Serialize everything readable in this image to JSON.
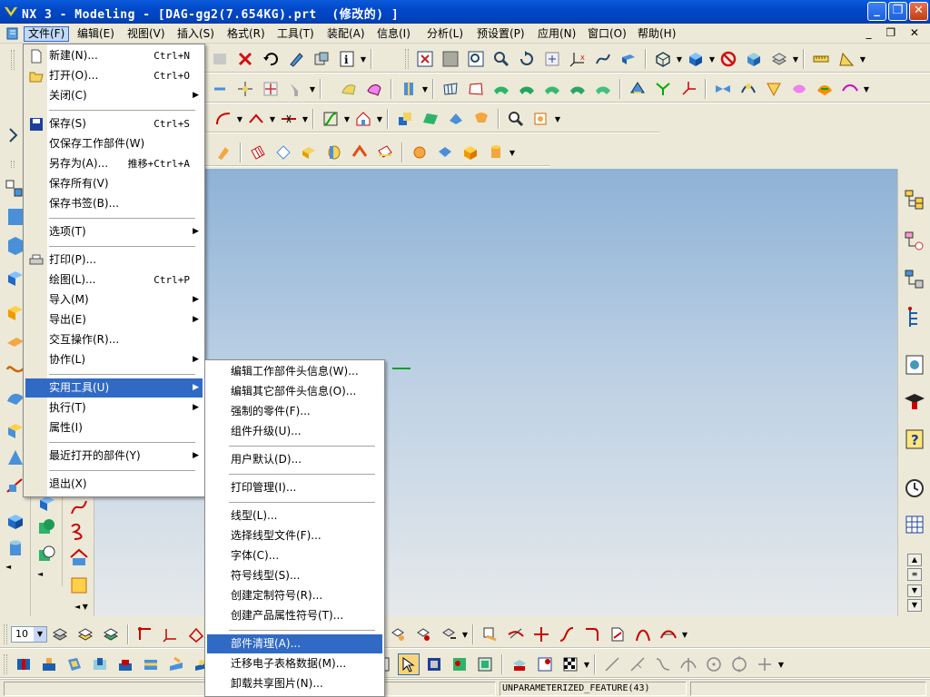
{
  "window": {
    "title": "NX 3 - Modeling - [DAG-gg2(7.654KG).prt  (修改的) ]",
    "controls": {
      "minimize": "_",
      "maximize": "❐",
      "close": "✕"
    }
  },
  "menubar": {
    "items": [
      "文件(F)",
      "编辑(E)",
      "视图(V)",
      "插入(S)",
      "格式(R)",
      "工具(T)",
      "装配(A)",
      "信息(I)",
      "分析(L)",
      "预设置(P)",
      "应用(N)",
      "窗口(O)",
      "帮助(H)"
    ],
    "mdi_controls": "_ ❐ ✕",
    "active": "文件(F)"
  },
  "file_menu": {
    "items": [
      {
        "label": "新建(N)...",
        "accel": "Ctrl+N",
        "icon": "new-file-icon"
      },
      {
        "label": "打开(O)...",
        "accel": "Ctrl+O",
        "icon": "open-folder-icon"
      },
      {
        "label": "关闭(C)",
        "submenu": true
      },
      {
        "label": "保存(S)",
        "accel": "Ctrl+S",
        "icon": "save-icon"
      },
      {
        "label": "仅保存工作部件(W)"
      },
      {
        "label": "另存为(A)...",
        "accel": "推移+Ctrl+A"
      },
      {
        "label": "保存所有(V)"
      },
      {
        "label": "保存书签(B)..."
      },
      {
        "label": "选项(T)",
        "submenu": true
      },
      {
        "label": "打印(P)...",
        "icon": "printer-icon"
      },
      {
        "label": "绘图(L)...",
        "accel": "Ctrl+P"
      },
      {
        "label": "导入(M)",
        "submenu": true
      },
      {
        "label": "导出(E)",
        "submenu": true
      },
      {
        "label": "交互操作(R)..."
      },
      {
        "label": "协作(L)",
        "submenu": true
      },
      {
        "label": "实用工具(U)",
        "submenu": true,
        "highlighted": true
      },
      {
        "label": "执行(T)",
        "submenu": true
      },
      {
        "label": "属性(I)"
      },
      {
        "label": "最近打开的部件(Y)",
        "submenu": true
      },
      {
        "label": "退出(X)"
      }
    ]
  },
  "utilities_menu": {
    "items": [
      {
        "label": "编辑工作部件头信息(W)..."
      },
      {
        "label": "编辑其它部件头信息(O)..."
      },
      {
        "label": "强制的零件(F)..."
      },
      {
        "label": "组件升级(U)..."
      },
      {
        "label": "用户默认(D)..."
      },
      {
        "label": "打印管理(I)..."
      },
      {
        "label": "线型(L)..."
      },
      {
        "label": "选择线型文件(F)..."
      },
      {
        "label": "字体(C)..."
      },
      {
        "label": "符号线型(S)..."
      },
      {
        "label": "创建定制符号(R)..."
      },
      {
        "label": "创建产品属性符号(T)..."
      },
      {
        "label": "部件清理(A)...",
        "highlighted": true
      },
      {
        "label": "迁移电子表格数据(M)..."
      },
      {
        "label": "卸载共享图片(N)..."
      }
    ]
  },
  "bottom_toolbar": {
    "zoom_value": "10"
  },
  "status": {
    "text": "UNPARAMETERIZED_FEATURE(43)"
  },
  "colors": {
    "titlebar": "#0248c9",
    "menu_highlight": "#316ac5",
    "graphics_top": "#8eb2d6",
    "graphics_bottom": "#e6e9eb"
  }
}
